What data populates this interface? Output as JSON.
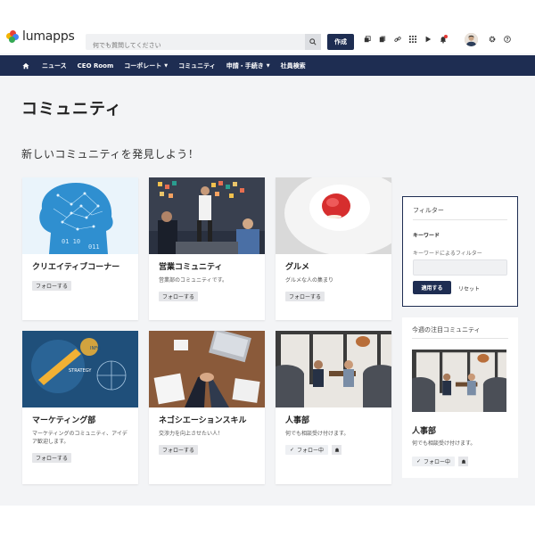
{
  "app": {
    "logo_text": "lumapps",
    "brand_color": "#1e2d52"
  },
  "search": {
    "placeholder": "何でも質問してください"
  },
  "toolbar": {
    "create_label": "作成",
    "icons": [
      "stack-icon",
      "copy-icon",
      "link-icon",
      "grid-icon",
      "play-icon",
      "bell-icon",
      "avatar",
      "gear-icon",
      "help-icon"
    ]
  },
  "nav": {
    "items": [
      {
        "label": "ニュース"
      },
      {
        "label": "CEO Room"
      },
      {
        "label": "コーポレート",
        "has_caret": true
      },
      {
        "label": "コミュニティ"
      },
      {
        "label": "申請・手続き",
        "has_caret": true
      },
      {
        "label": "社員検索"
      }
    ]
  },
  "page": {
    "title": "コミュニティ",
    "section_title": "新しいコミュニティを発見しよう！"
  },
  "cards": [
    {
      "title": "クリエイティブコーナー",
      "desc": "",
      "action": "フォローする"
    },
    {
      "title": "営業コミュニティ",
      "desc": "営業部のコミュニティです。",
      "action": "フォローする"
    },
    {
      "title": "グルメ",
      "desc": "グルメな人の集まり",
      "action": "フォローする"
    },
    {
      "title": "マーケティング部",
      "desc": "マーケティングのコミュニティ、アイデア歓迎します。",
      "action": "フォローする"
    },
    {
      "title": "ネゴシエーションスキル",
      "desc": "交渉力を向上させたい人！",
      "action": "フォローする"
    },
    {
      "title": "人事部",
      "desc": "何でも相談受け付けます。",
      "action": "フォロー中"
    }
  ],
  "filter": {
    "title": "フィルター",
    "keyword_label": "キーワード",
    "keyword_hint": "キーワードによるフィルター",
    "apply_label": "適用する",
    "reset_label": "リセット"
  },
  "featured": {
    "title": "今週の注目コミュニティ",
    "name": "人事部",
    "desc": "何でも相談受け付けます。",
    "action": "フォロー中"
  }
}
